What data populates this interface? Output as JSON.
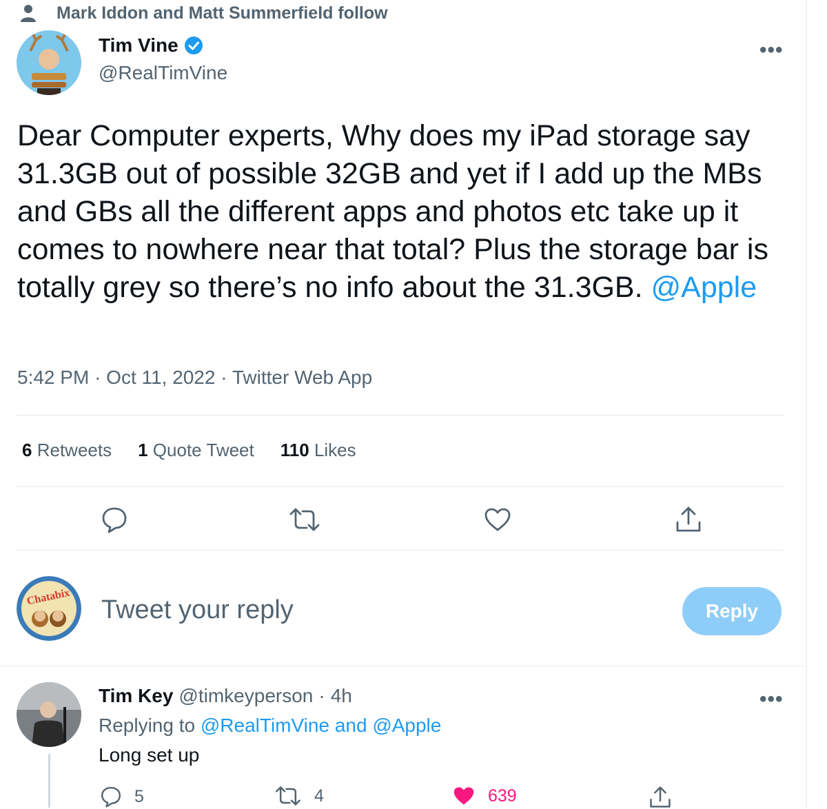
{
  "social_context": {
    "text": "Mark Iddon and Matt Summerfield follow",
    "icon": "person-icon"
  },
  "tweet": {
    "author_name": "Tim Vine",
    "author_handle": "@RealTimVine",
    "verified": true,
    "text": "Dear Computer experts, Why does my iPad storage say 31.3GB out of possible 32GB and yet if I add up the MBs and GBs all the different apps and photos etc take up it comes to nowhere near that total? Plus the storage bar is totally grey so there’s no info about the 31.3GB.",
    "mention": "@Apple",
    "time": "5:42 PM",
    "date": "Oct 11, 2022",
    "source": "Twitter Web App",
    "meta_sep": "·",
    "more_label": "•••"
  },
  "stats": {
    "retweets_count": "6",
    "retweets_label": "Retweets",
    "quotes_count": "1",
    "quotes_label": "Quote Tweet",
    "likes_count": "110",
    "likes_label": "Likes"
  },
  "actions": [
    "reply-icon",
    "retweet-icon",
    "like-icon",
    "share-icon"
  ],
  "composer": {
    "avatar_text": "Chatabix",
    "placeholder": "Tweet your reply",
    "button_label": "Reply"
  },
  "reply": {
    "author_name": "Tim Key",
    "author_handle": "@timkeyperson",
    "sep": "·",
    "time": "4h",
    "replying_prefix": "Replying to",
    "replying_user1": "@RealTimVine",
    "replying_and": "and",
    "replying_user2": "@Apple",
    "text": "Long set up",
    "reply_count": "5",
    "retweet_count": "4",
    "like_count": "639",
    "more_label": "•••"
  },
  "colors": {
    "accent": "#1d9bf0",
    "like": "#f91880",
    "muted": "#536471",
    "reply_button": "#8ecdf8"
  }
}
